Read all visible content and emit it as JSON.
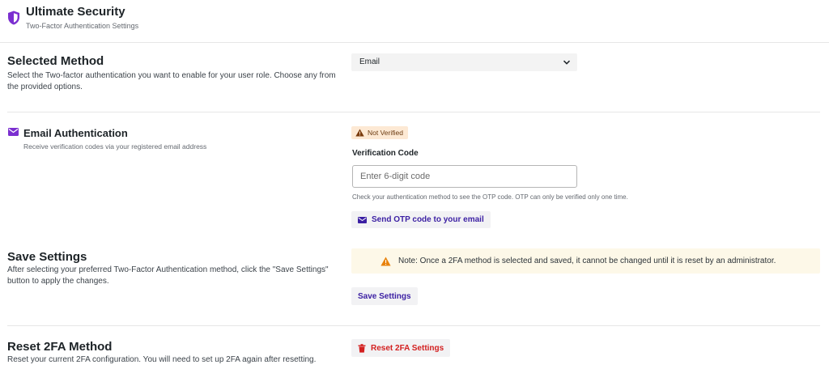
{
  "header": {
    "title": "Ultimate Security",
    "subtitle": "Two-Factor Authentication Settings",
    "icon": "shield-icon",
    "accent": "#7b2fd0"
  },
  "selected_method": {
    "title": "Selected Method",
    "description": "Select the Two-factor authentication you want to enable for your user role. Choose any from the provided options.",
    "select_value": "Email"
  },
  "email_auth": {
    "title": "Email Authentication",
    "subtitle": "Receive verification codes via your registered email address",
    "status_badge": "Not Verified",
    "verification_label": "Verification Code",
    "input_value": "",
    "input_placeholder": "Enter 6-digit code",
    "hint": "Check your authentication method to see the OTP code. OTP can only be verified only one time.",
    "send_button": "Send OTP code to your email"
  },
  "save_settings": {
    "title": "Save Settings",
    "description": "After selecting your preferred Two-Factor Authentication method, click the \"Save Settings\" button to apply the changes.",
    "note": "Note: Once a 2FA method is selected and saved, it cannot be changed until it is reset by an administrator.",
    "button": "Save Settings"
  },
  "reset": {
    "title": "Reset 2FA Method",
    "description": "Reset your current 2FA configuration. You will need to set up 2FA again after resetting.",
    "button": "Reset 2FA Settings"
  },
  "colors": {
    "accent": "#7b2fd0",
    "button_text": "#3b1fa3",
    "danger": "#d32020",
    "warning": "#e8820c"
  }
}
